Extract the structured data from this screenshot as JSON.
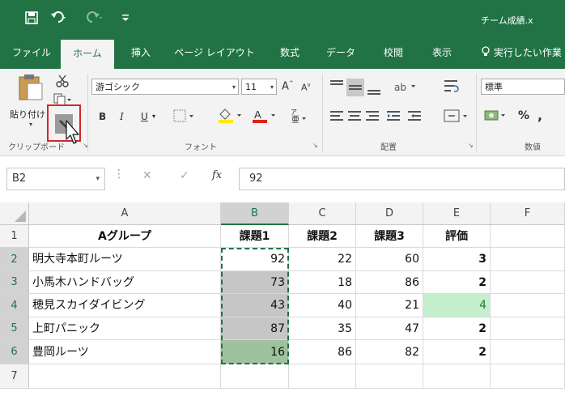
{
  "quick_access": {
    "save_icon": "save-icon",
    "undo_icon": "undo-icon",
    "redo_icon": "redo-icon",
    "customize_icon": "customize-icon"
  },
  "window": {
    "title": "チーム成績.x"
  },
  "tabs": [
    {
      "label": "ファイル"
    },
    {
      "label": "ホーム",
      "active": true
    },
    {
      "label": "挿入"
    },
    {
      "label": "ページ レイアウト"
    },
    {
      "label": "数式"
    },
    {
      "label": "データ"
    },
    {
      "label": "校閲"
    },
    {
      "label": "表示"
    }
  ],
  "tell_me": {
    "label": "実行したい作業"
  },
  "ribbon": {
    "clipboard": {
      "paste_label": "貼り付け",
      "group_label": "クリップボード"
    },
    "font": {
      "font_name": "游ゴシック",
      "font_size": "11",
      "bold": "B",
      "italic": "I",
      "underline": "U",
      "group_label": "フォント"
    },
    "alignment": {
      "group_label": "配置"
    },
    "number": {
      "format": "標準",
      "percent": "%",
      "comma": ",",
      "group_label": "数値"
    }
  },
  "formula_bar": {
    "name_box": "B2",
    "fx": "fx",
    "value": "92"
  },
  "columns": [
    "A",
    "B",
    "C",
    "D",
    "E",
    "F"
  ],
  "rows": [
    "1",
    "2",
    "3",
    "4",
    "5",
    "6",
    "7"
  ],
  "header_row": {
    "name": "Aグループ",
    "task1": "課題1",
    "task2": "課題2",
    "task3": "課題3",
    "eval": "評価"
  },
  "data_rows": [
    {
      "name": "明大寺本町ルーツ",
      "task1": "92",
      "task2": "22",
      "task3": "60",
      "eval": "3"
    },
    {
      "name": "小馬木ハンドバッグ",
      "task1": "73",
      "task2": "18",
      "task3": "86",
      "eval": "2"
    },
    {
      "name": "穂見スカイダイビング",
      "task1": "43",
      "task2": "40",
      "task3": "21",
      "eval": "4"
    },
    {
      "name": "上町パニック",
      "task1": "87",
      "task2": "35",
      "task3": "47",
      "eval": "2"
    },
    {
      "name": "豊岡ルーツ",
      "task1": "16",
      "task2": "86",
      "task3": "82",
      "eval": "2"
    }
  ],
  "colors": {
    "excel_green": "#217346",
    "selection_gray": "#c6c6c6",
    "highlight_green": "#c6efce",
    "format_painter_border": "#d3262a"
  }
}
